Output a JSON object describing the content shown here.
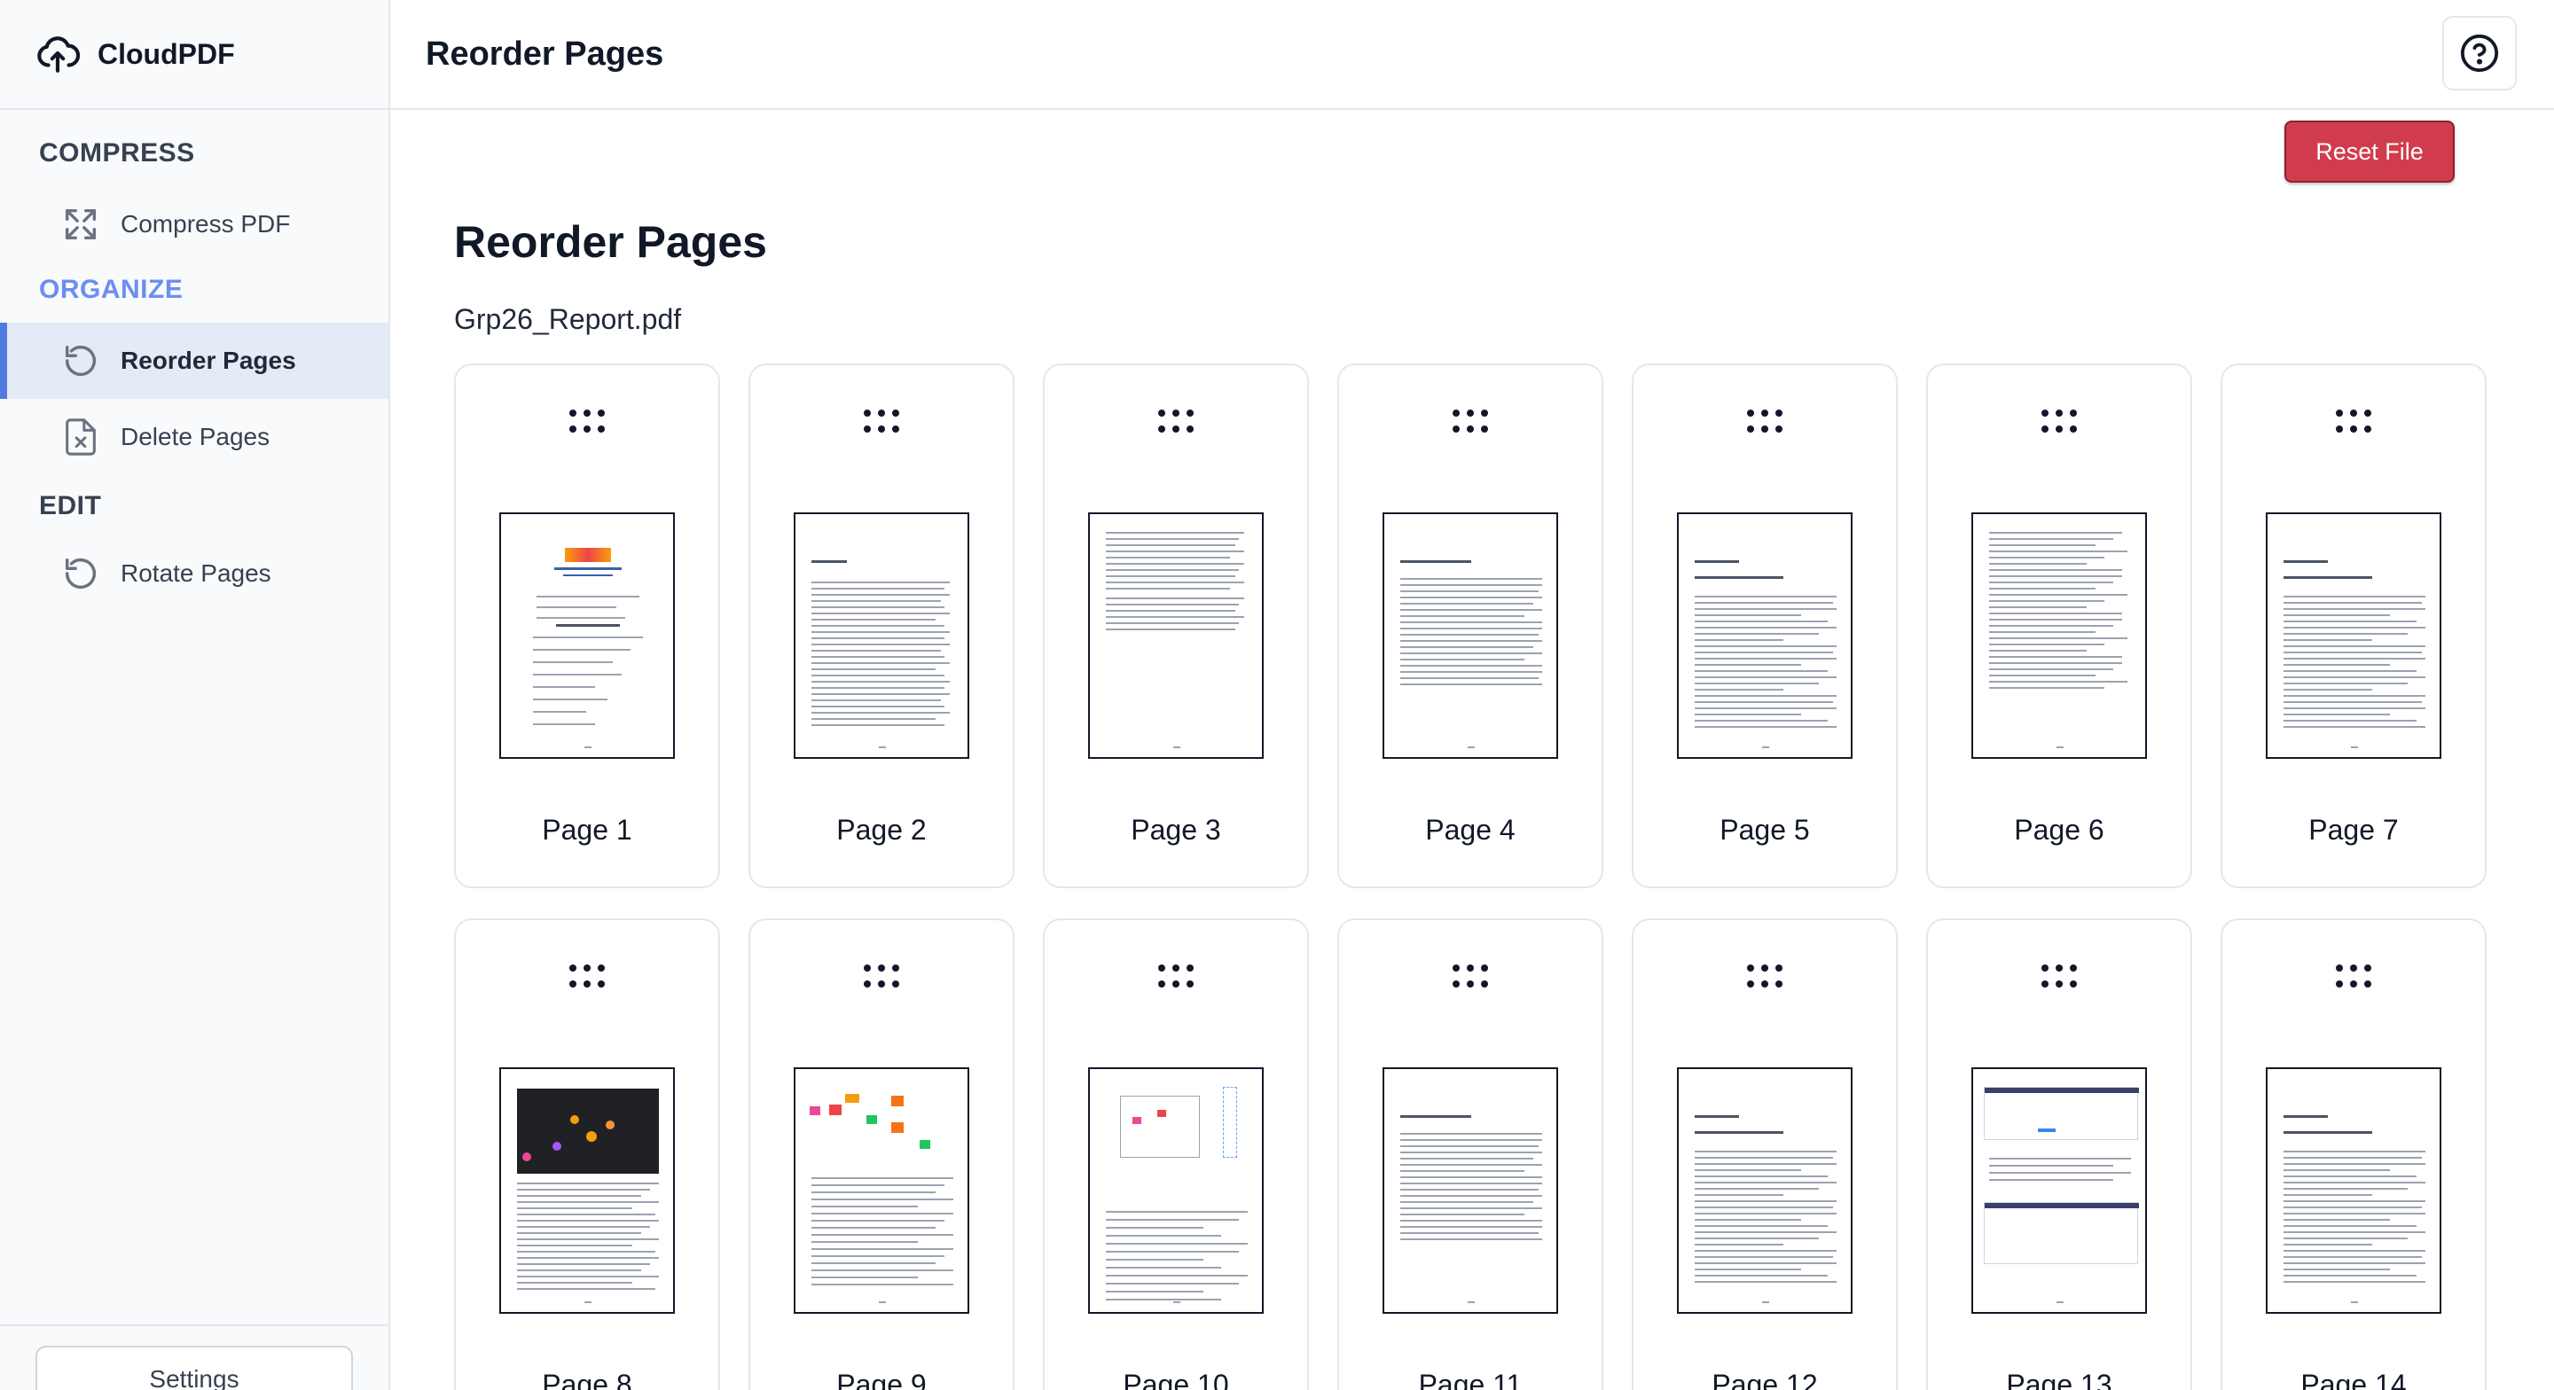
{
  "app": {
    "name": "CloudPDF"
  },
  "sidebar": {
    "sections": [
      {
        "title": "COMPRESS",
        "items": [
          {
            "label": "Compress PDF",
            "icon": "compress-icon"
          }
        ]
      },
      {
        "title": "ORGANIZE",
        "items": [
          {
            "label": "Reorder Pages",
            "icon": "reorder-icon"
          },
          {
            "label": "Delete Pages",
            "icon": "delete-file-icon"
          }
        ]
      },
      {
        "title": "EDIT",
        "items": [
          {
            "label": "Rotate Pages",
            "icon": "rotate-icon"
          }
        ]
      }
    ],
    "settings_label": "Settings"
  },
  "header": {
    "title": "Reorder Pages",
    "help_icon": "help-icon"
  },
  "main": {
    "title": "Reorder Pages",
    "reset_label": "Reset File",
    "filename": "Grp26_Report.pdf",
    "pages": [
      {
        "label": "Page 1",
        "kind": "cover"
      },
      {
        "label": "Page 2",
        "kind": "toc"
      },
      {
        "label": "Page 3",
        "kind": "toc-short"
      },
      {
        "label": "Page 4",
        "kind": "text"
      },
      {
        "label": "Page 5",
        "kind": "chapter"
      },
      {
        "label": "Page 6",
        "kind": "list"
      },
      {
        "label": "Page 7",
        "kind": "chapter"
      },
      {
        "label": "Page 8",
        "kind": "image-dark"
      },
      {
        "label": "Page 9",
        "kind": "diagram"
      },
      {
        "label": "Page 10",
        "kind": "diagram-small"
      },
      {
        "label": "Page 11",
        "kind": "text"
      },
      {
        "label": "Page 12",
        "kind": "chapter"
      },
      {
        "label": "Page 13",
        "kind": "screenshots"
      },
      {
        "label": "Page 14",
        "kind": "chapter"
      }
    ]
  },
  "colors": {
    "accent": "#4f7be0",
    "danger": "#d03c4d",
    "active_bg": "#e5eaf7"
  }
}
